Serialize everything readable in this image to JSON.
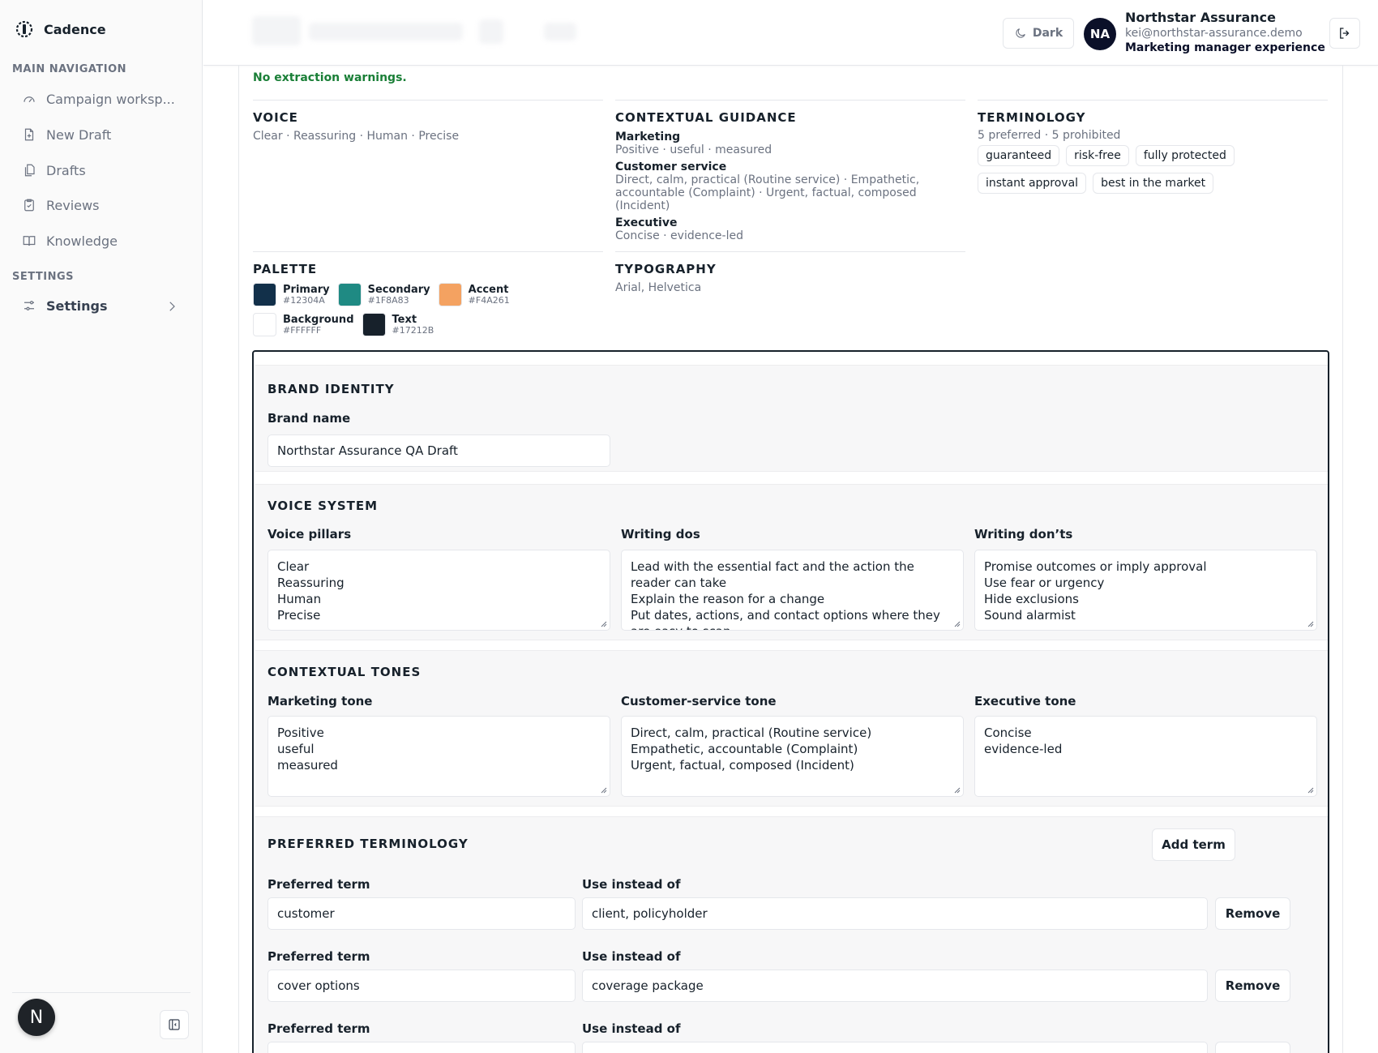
{
  "app": {
    "name": "Cadence"
  },
  "sidebar": {
    "main_nav_label": "MAIN NAVIGATION",
    "items": [
      {
        "label": "Campaign worksp...",
        "icon": "gauge-icon"
      },
      {
        "label": "New Draft",
        "icon": "file-plus-icon"
      },
      {
        "label": "Drafts",
        "icon": "files-icon"
      },
      {
        "label": "Reviews",
        "icon": "clipboard-check-icon"
      },
      {
        "label": "Knowledge",
        "icon": "book-icon"
      }
    ],
    "settings_label": "SETTINGS",
    "settings_item": "Settings",
    "avatar_letter": "N"
  },
  "topbar": {
    "dark_label": "Dark",
    "user_initials": "NA",
    "user_name": "Northstar Assurance",
    "user_email": "kei@northstar-assurance.demo",
    "user_role": "Marketing manager experience"
  },
  "summary": {
    "warnings": "No extraction warnings.",
    "voice_title": "VOICE",
    "voice_text": "Clear · Reassuring · Human · Precise",
    "contextual_title": "CONTEXTUAL GUIDANCE",
    "marketing_h": "Marketing",
    "marketing_text": "Positive · useful · measured",
    "cs_h": "Customer service",
    "cs_text": "Direct, calm, practical (Routine service) · Empathetic, accountable (Complaint) · Urgent, factual, composed (Incident)",
    "exec_h": "Executive",
    "exec_text": "Concise · evidence-led",
    "terminology_title": "TERMINOLOGY",
    "terminology_counts": "5 preferred · 5 prohibited",
    "prohibited_chips": [
      "guaranteed",
      "risk-free",
      "fully protected",
      "instant approval",
      "best in the market"
    ],
    "palette_title": "PALETTE",
    "palette": [
      {
        "name": "Primary",
        "hex": "#12304A"
      },
      {
        "name": "Secondary",
        "hex": "#1F8A83"
      },
      {
        "name": "Accent",
        "hex": "#F4A261"
      },
      {
        "name": "Background",
        "hex": "#FFFFFF"
      },
      {
        "name": "Text",
        "hex": "#17212B"
      }
    ],
    "typography_title": "TYPOGRAPHY",
    "typography_text": "Arial, Helvetica"
  },
  "form": {
    "identity_title": "BRAND IDENTITY",
    "brand_name_label": "Brand name",
    "brand_name_value": "Northstar Assurance QA Draft",
    "voice_system_title": "VOICE SYSTEM",
    "voice_pillars_label": "Voice pillars",
    "voice_pillars_value": "Clear\nReassuring\nHuman\nPrecise",
    "writing_dos_label": "Writing dos",
    "writing_dos_value": "Lead with the essential fact and the action the reader can take\nExplain the reason for a change\nPut dates, actions, and contact options where they are easy to scan",
    "writing_donts_label": "Writing don’ts",
    "writing_donts_value": "Promise outcomes or imply approval\nUse fear or urgency\nHide exclusions\nSound alarmist",
    "contextual_tones_title": "CONTEXTUAL TONES",
    "marketing_tone_label": "Marketing tone",
    "marketing_tone_value": "Positive\nuseful\nmeasured",
    "cs_tone_label": "Customer-service tone",
    "cs_tone_value": "Direct, calm, practical (Routine service)\nEmpathetic, accountable (Complaint)\nUrgent, factual, composed (Incident)",
    "exec_tone_label": "Executive tone",
    "exec_tone_value": "Concise\nevidence-led",
    "preferred_title": "PREFERRED TERMINOLOGY",
    "add_term_label": "Add term",
    "preferred_term_label": "Preferred term",
    "use_instead_label": "Use instead of",
    "remove_label": "Remove",
    "terms": [
      {
        "preferred": "customer",
        "instead": "client, policyholder"
      },
      {
        "preferred": "cover options",
        "instead": "coverage package"
      }
    ]
  }
}
